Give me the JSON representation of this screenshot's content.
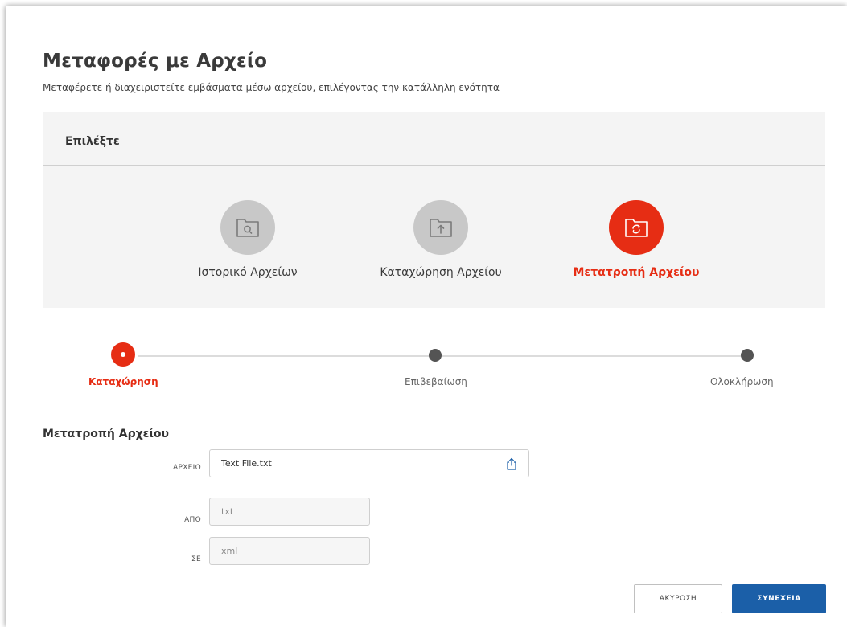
{
  "page": {
    "title": "Μεταφορές με Αρχείο",
    "subtitle": "Μεταφέρετε ή διαχειριστείτε εμβάσματα μέσω αρχείου, επιλέγοντας την κατάλληλη ενότητα"
  },
  "selector": {
    "header": "Επιλέξτε",
    "options": [
      {
        "label": "Ιστορικό Αρχείων",
        "icon": "folder-search-icon",
        "active": false
      },
      {
        "label": "Καταχώρηση Αρχείου",
        "icon": "folder-upload-icon",
        "active": false
      },
      {
        "label": "Μετατροπή Αρχείου",
        "icon": "folder-convert-icon",
        "active": true
      }
    ]
  },
  "stepper": {
    "steps": [
      {
        "label": "Καταχώρηση",
        "active": true
      },
      {
        "label": "Επιβεβαίωση",
        "active": false
      },
      {
        "label": "Ολοκλήρωση",
        "active": false
      }
    ]
  },
  "form": {
    "title": "Μετατροπή Αρχείου",
    "file": {
      "label": "ΑΡΧΕΙΟ",
      "value": "Text File.txt",
      "icon": "upload-icon"
    },
    "from": {
      "label": "ΑΠΟ",
      "value": "txt"
    },
    "to": {
      "label": "ΣΕ",
      "value": "xml"
    }
  },
  "buttons": {
    "cancel": "ΑΚΥΡΩΣΗ",
    "continue": "ΣΥΝΕΧΕΙΑ"
  },
  "colors": {
    "accent": "#e62d14",
    "primary_button": "#1b5fa8",
    "inactive_circle": "#c8c8c8",
    "panel_bg": "#f4f4f4"
  }
}
